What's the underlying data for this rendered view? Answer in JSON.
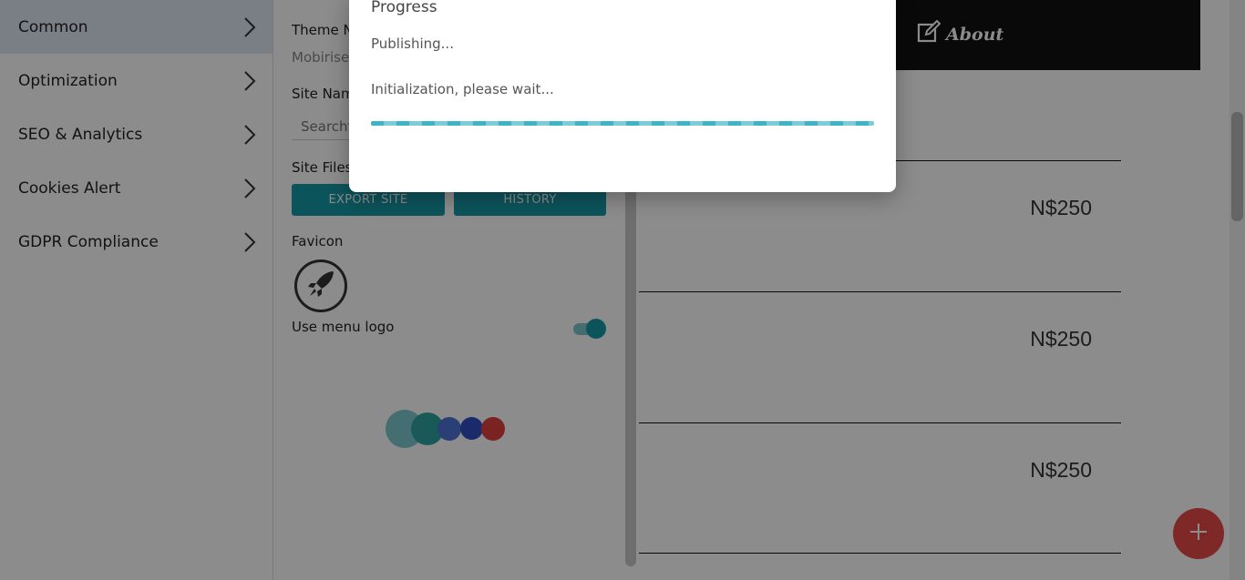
{
  "menu": {
    "items": [
      {
        "label": "Common",
        "active": true
      },
      {
        "label": "Optimization",
        "active": false
      },
      {
        "label": "SEO & Analytics",
        "active": false
      },
      {
        "label": "Cookies Alert",
        "active": false
      },
      {
        "label": "GDPR Compliance",
        "active": false
      }
    ]
  },
  "settings": {
    "theme_label": "Theme N",
    "theme_value": "Mobirise",
    "site_name_label": "Site Nam",
    "search_placeholder": "Searchf",
    "site_files_label": "Site Files",
    "export_label": "EXPORT SITE",
    "history_label": "HISTORY",
    "favicon_label": "Favicon",
    "menu_logo_label": "Use menu logo",
    "menu_logo_enabled": true
  },
  "preview": {
    "nav_about": "About",
    "prices": [
      "N$250",
      "N$250",
      "N$250"
    ]
  },
  "modal": {
    "title": "Progress",
    "status": "Publishing...",
    "message": "Initialization, please wait..."
  },
  "colors": {
    "accent": "#169aa6",
    "fab": "#e64a4a",
    "menu_active": "#dfe6f3"
  },
  "icons": [
    "chevron-right-icon",
    "rocket-icon",
    "edit-icon",
    "plus-icon"
  ]
}
